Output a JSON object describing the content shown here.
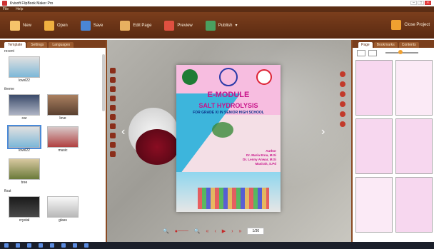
{
  "window": {
    "title": "Kvisoft FlipBook Maker Pro"
  },
  "menu": {
    "items": [
      "File",
      "Help"
    ]
  },
  "toolbar": {
    "new_label": "New",
    "open_label": "Open",
    "save_label": "Save",
    "edit_label": "Edit Page",
    "preview_label": "Preview",
    "publish_label": "Publish",
    "close_label": "Close Project"
  },
  "left": {
    "tabs": [
      "Template",
      "Settings",
      "Languages"
    ],
    "sections": [
      "recent",
      "theme",
      "float"
    ],
    "recent_thumbs": [
      "lovel22"
    ],
    "theme_thumbs": [
      "car",
      "love",
      "lovel22",
      "music",
      "tree"
    ],
    "float_thumbs": [
      "crystal",
      "glass"
    ]
  },
  "book": {
    "title": "E-MODULE",
    "subtitle": "SALT HYDROLYSIS",
    "grade": "FOR GRADE XI IN SENIOR HIGH SCHOOL",
    "author_label": "Author",
    "authors": [
      "Dr. Maria Erna, M.Si",
      "Dr. Lenny Anwar, M.Si",
      "Masirah, S.Pd"
    ]
  },
  "nav": {
    "page_indicator": "1/30"
  },
  "right": {
    "tabs": [
      "Page",
      "Bookmarks",
      "Contents"
    ]
  },
  "colors": {
    "brand": "#6b3418",
    "accent": "#f0a030",
    "title_pink": "#c8138a"
  }
}
